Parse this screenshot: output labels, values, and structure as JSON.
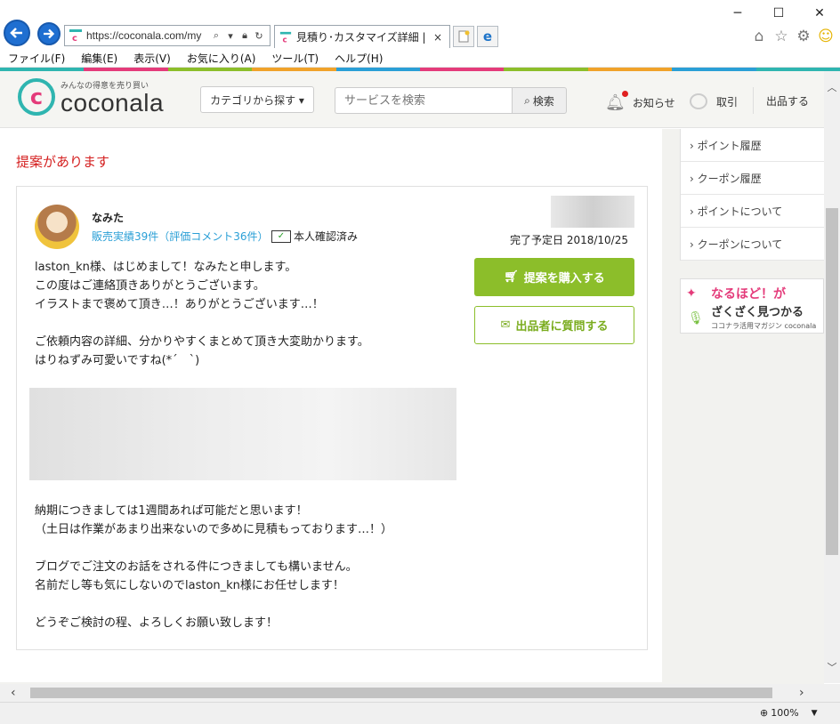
{
  "browser": {
    "url": "https://coconala.com/my",
    "tab_title": "見積り･カスタマイズ詳細 | ココ...",
    "tab_close": "×",
    "menu": [
      "ファイル(F)",
      "編集(E)",
      "表示(V)",
      "お気に入り(A)",
      "ツール(T)",
      "ヘルプ(H)"
    ],
    "window_buttons": {
      "minimize": "─",
      "maximize": "☐",
      "close": "✕"
    },
    "zoom": "100%"
  },
  "stripe_colors": [
    "#2fb5b0",
    "#e43b7a",
    "#8cbe2a",
    "#f0a22a",
    "#2a9fd6",
    "#e43b7a",
    "#8cbe2a",
    "#f0a22a",
    "#2a9fd6",
    "#2fb5b0"
  ],
  "header": {
    "tagline": "みんなの得意を売り買い",
    "logo_name": "coconala",
    "category_btn": "カテゴリから探す ▾",
    "search_placeholder": "サービスを検索",
    "search_btn": "検索",
    "notice": "お知らせ",
    "trade": "取引",
    "sell": "出品する"
  },
  "main": {
    "heading": "提案があります",
    "seller": {
      "name": "なみた",
      "stats": "販売実績39件（評価コメント36件）",
      "verified": "本人確認済み"
    },
    "due_date": "完了予定日 2018/10/25",
    "buy_btn": "提案を購入する",
    "ask_btn": "出品者に質問する",
    "message_part1": "laston_kn様、はじめまして！なみたと申します。\nこの度はご連絡頂きありがとうございます。\nイラストまで褒めて頂き…！ありがとうございます…！\n\nご依頼内容の詳細、分かりやすくまとめて頂き大変助かります。\nはりねずみ可愛いですね(*´　`)",
    "message_part2": "納期につきましては1週間あれば可能だと思います！\n（土日は作業があまり出来ないので多めに見積もっております…！）\n\nブログでご注文のお話をされる件につきましても構いません。\n名前だし等も気にしないのでlaston_kn様にお任せします！\n\nどうぞご検討の程、よろしくお願い致します！"
  },
  "sidebar": {
    "items": [
      "› ポイント履歴",
      "› クーポン履歴",
      "› ポイントについて",
      "› クーポンについて"
    ],
    "banner": {
      "line1": "なるほど！が",
      "line2": "ざくざく見つかる",
      "line3": "ココナラ活用マガジン coconala"
    }
  }
}
